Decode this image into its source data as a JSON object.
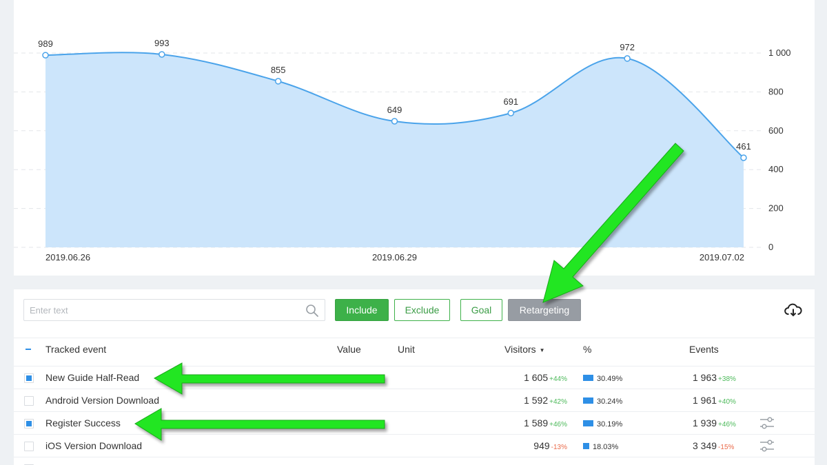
{
  "colors": {
    "accent_blue": "#2e8fe6",
    "area_fill": "#cce5fb",
    "line": "#4aa3ea",
    "include_green": "#3db149",
    "retarget_gray": "#979ca3",
    "delta_up": "#4cb95a",
    "delta_down": "#ea6a4a",
    "arrow_green": "#22e622"
  },
  "chart_data": {
    "type": "area",
    "x": [
      "2019.06.26",
      "2019.06.27",
      "2019.06.28",
      "2019.06.29",
      "2019.06.30",
      "2019.07.01",
      "2019.07.02"
    ],
    "values": [
      989,
      993,
      855,
      649,
      691,
      972,
      461
    ],
    "value_labels": [
      "989",
      "993",
      "855",
      "649",
      "691",
      "972",
      "461"
    ],
    "x_tick_labels": [
      "2019.06.26",
      "2019.06.29",
      "2019.07.02"
    ],
    "y_ticks": [
      0,
      200,
      400,
      600,
      800,
      1000
    ],
    "y_tick_labels": [
      "0",
      "200",
      "400",
      "600",
      "800",
      "1 000"
    ],
    "ylim": [
      0,
      1000
    ],
    "y_axis_side": "right",
    "grid": "horizontal dashed",
    "title": "",
    "xlabel": "",
    "ylabel": ""
  },
  "toolbar": {
    "search_placeholder": "Enter text",
    "include_label": "Include",
    "exclude_label": "Exclude",
    "goal_label": "Goal",
    "retargeting_label": "Retargeting"
  },
  "table": {
    "headers": {
      "event": "Tracked event",
      "value": "Value",
      "unit": "Unit",
      "visitors": "Visitors",
      "sort_indicator": "▼",
      "percent": "%",
      "events": "Events"
    },
    "rows": [
      {
        "name": "New Guide Half-Read",
        "checked": true,
        "visitors": "1 605",
        "visitors_delta": "+44%",
        "visitors_dir": "up",
        "percent": "30.49%",
        "percent_value": 30.49,
        "events": "1 963",
        "events_delta": "+38%",
        "events_dir": "up",
        "filter_icon": false
      },
      {
        "name": "Android Version Download",
        "checked": false,
        "visitors": "1 592",
        "visitors_delta": "+42%",
        "visitors_dir": "up",
        "percent": "30.24%",
        "percent_value": 30.24,
        "events": "1 961",
        "events_delta": "+40%",
        "events_dir": "up",
        "filter_icon": false
      },
      {
        "name": "Register Success",
        "checked": true,
        "visitors": "1 589",
        "visitors_delta": "+46%",
        "visitors_dir": "up",
        "percent": "30.19%",
        "percent_value": 30.19,
        "events": "1 939",
        "events_delta": "+46%",
        "events_dir": "up",
        "filter_icon": true
      },
      {
        "name": "iOS Version Download",
        "checked": false,
        "visitors": "949",
        "visitors_delta": "-13%",
        "visitors_dir": "down",
        "percent": "18.03%",
        "percent_value": 18.03,
        "events": "3 349",
        "events_delta": "-15%",
        "events_dir": "down",
        "filter_icon": true
      }
    ]
  },
  "icons": {
    "search": "search-icon",
    "download": "cloud-download-icon",
    "row_filter": "sliders-icon",
    "annotation": "green-arrow"
  }
}
